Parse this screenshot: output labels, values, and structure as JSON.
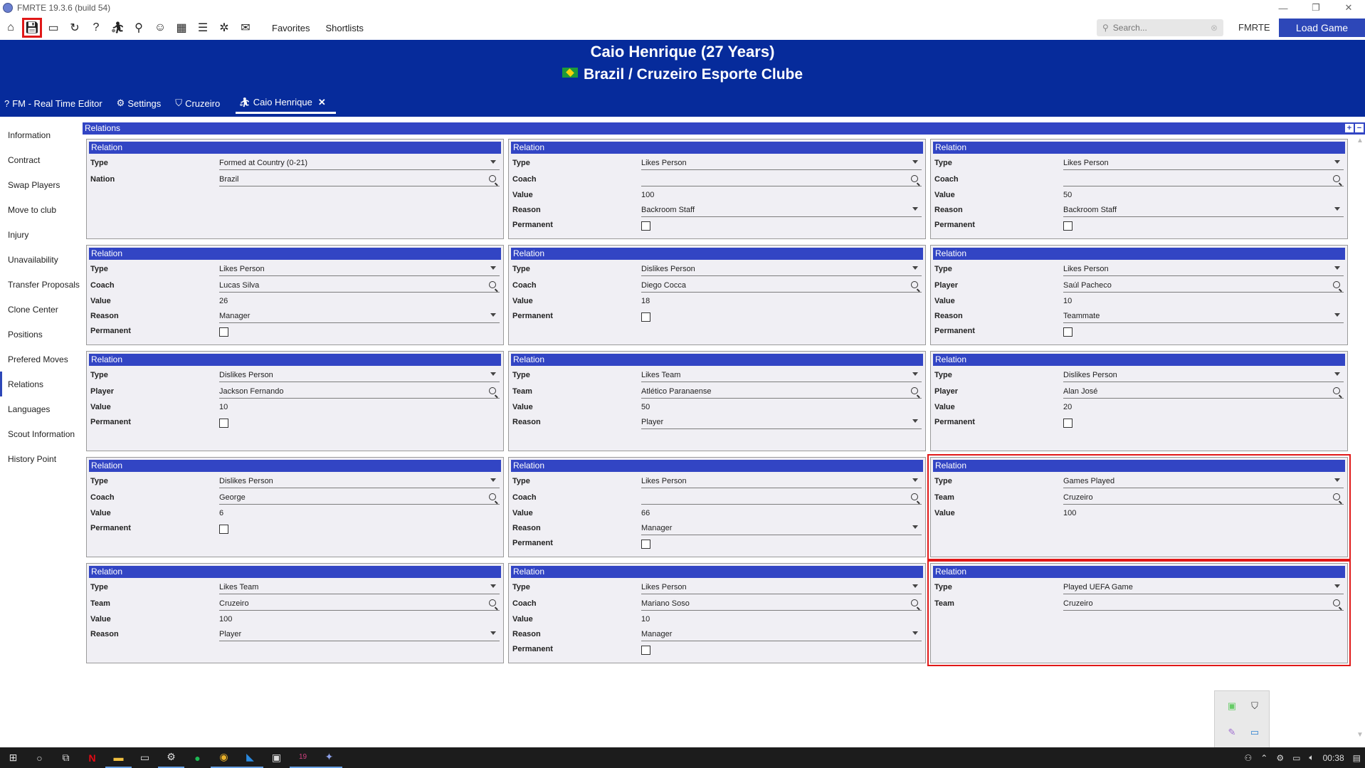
{
  "window": {
    "title": "FMRTE 19.3.6 (build 54)",
    "controls": [
      "—",
      "❐",
      "✕"
    ]
  },
  "toolbar": {
    "icons": [
      "home-icon",
      "save-icon",
      "monitor-icon",
      "refresh-icon",
      "help-icon",
      "player-icon",
      "binoculars-icon",
      "people-icon",
      "calendar-icon",
      "notes-icon",
      "soccer-icon",
      "mail-icon"
    ],
    "favorites": "Favorites",
    "shortlists": "Shortlists",
    "search_placeholder": "Search...",
    "fmrte_label": "FMRTE",
    "load_game": "Load Game",
    "highlighted_icon": "save-icon"
  },
  "header": {
    "player_name": "Caio Henrique (27 Years)",
    "club_line": "Brazil / Cruzeiro Esporte Clube",
    "tabs": [
      {
        "label": "FM - Real Time Editor",
        "icon": "help-icon"
      },
      {
        "label": "Settings",
        "icon": "gear-icon"
      },
      {
        "label": "Cruzeiro",
        "icon": "shield-icon"
      },
      {
        "label": "Caio Henrique",
        "icon": "player-icon",
        "active": true
      }
    ]
  },
  "sidebar": {
    "items": [
      "Information",
      "Contract",
      "Swap Players",
      "Move to club",
      "Injury",
      "Unavailability",
      "Transfer Proposals",
      "Clone Center",
      "Positions",
      "Prefered Moves",
      "Relations",
      "Languages",
      "Scout Information",
      "History Point"
    ],
    "active": "Relations"
  },
  "main": {
    "section_title": "Relations",
    "card_header": "Relation",
    "cards": [
      {
        "rows": [
          {
            "label": "Type",
            "value": "Formed at Country (0-21)",
            "kind": "dropdown"
          },
          {
            "label": "Nation",
            "value": "Brazil",
            "kind": "search"
          }
        ]
      },
      {
        "rows": [
          {
            "label": "Type",
            "value": "Likes Person",
            "kind": "dropdown"
          },
          {
            "label": "Coach",
            "value": "",
            "kind": "search"
          },
          {
            "label": "Value",
            "value": "100",
            "kind": "text"
          },
          {
            "label": "Reason",
            "value": "Backroom Staff",
            "kind": "dropdown"
          },
          {
            "label": "Permanent",
            "value": "",
            "kind": "checkbox"
          }
        ]
      },
      {
        "rows": [
          {
            "label": "Type",
            "value": "Likes Person",
            "kind": "dropdown"
          },
          {
            "label": "Coach",
            "value": "",
            "kind": "search"
          },
          {
            "label": "Value",
            "value": "50",
            "kind": "text"
          },
          {
            "label": "Reason",
            "value": "Backroom Staff",
            "kind": "dropdown"
          },
          {
            "label": "Permanent",
            "value": "",
            "kind": "checkbox"
          }
        ]
      },
      {
        "rows": [
          {
            "label": "Type",
            "value": "Likes Person",
            "kind": "dropdown"
          },
          {
            "label": "Coach",
            "value": "Lucas Silva",
            "kind": "search"
          },
          {
            "label": "Value",
            "value": "26",
            "kind": "text"
          },
          {
            "label": "Reason",
            "value": "Manager",
            "kind": "dropdown"
          },
          {
            "label": "Permanent",
            "value": "",
            "kind": "checkbox"
          }
        ]
      },
      {
        "rows": [
          {
            "label": "Type",
            "value": "Dislikes Person",
            "kind": "dropdown"
          },
          {
            "label": "Coach",
            "value": "Diego Cocca",
            "kind": "search"
          },
          {
            "label": "Value",
            "value": "18",
            "kind": "text"
          },
          {
            "label": "Permanent",
            "value": "",
            "kind": "checkbox"
          }
        ]
      },
      {
        "rows": [
          {
            "label": "Type",
            "value": "Likes Person",
            "kind": "dropdown"
          },
          {
            "label": "Player",
            "value": "Saúl Pacheco",
            "kind": "search"
          },
          {
            "label": "Value",
            "value": "10",
            "kind": "text"
          },
          {
            "label": "Reason",
            "value": "Teammate",
            "kind": "dropdown"
          },
          {
            "label": "Permanent",
            "value": "",
            "kind": "checkbox"
          }
        ]
      },
      {
        "rows": [
          {
            "label": "Type",
            "value": "Dislikes Person",
            "kind": "dropdown"
          },
          {
            "label": "Player",
            "value": "Jackson Fernando",
            "kind": "search"
          },
          {
            "label": "Value",
            "value": "10",
            "kind": "text"
          },
          {
            "label": "Permanent",
            "value": "",
            "kind": "checkbox"
          }
        ]
      },
      {
        "rows": [
          {
            "label": "Type",
            "value": "Likes Team",
            "kind": "dropdown"
          },
          {
            "label": "Team",
            "value": "Atlético Paranaense",
            "kind": "search"
          },
          {
            "label": "Value",
            "value": "50",
            "kind": "text"
          },
          {
            "label": "Reason",
            "value": "Player",
            "kind": "dropdown"
          }
        ]
      },
      {
        "rows": [
          {
            "label": "Type",
            "value": "Dislikes Person",
            "kind": "dropdown"
          },
          {
            "label": "Player",
            "value": "Alan José",
            "kind": "search"
          },
          {
            "label": "Value",
            "value": "20",
            "kind": "text"
          },
          {
            "label": "Permanent",
            "value": "",
            "kind": "checkbox"
          }
        ]
      },
      {
        "rows": [
          {
            "label": "Type",
            "value": "Dislikes Person",
            "kind": "dropdown"
          },
          {
            "label": "Coach",
            "value": "George",
            "kind": "search"
          },
          {
            "label": "Value",
            "value": "6",
            "kind": "text"
          },
          {
            "label": "Permanent",
            "value": "",
            "kind": "checkbox"
          }
        ]
      },
      {
        "rows": [
          {
            "label": "Type",
            "value": "Likes Person",
            "kind": "dropdown"
          },
          {
            "label": "Coach",
            "value": "",
            "kind": "search"
          },
          {
            "label": "Value",
            "value": "66",
            "kind": "text"
          },
          {
            "label": "Reason",
            "value": "Manager",
            "kind": "dropdown"
          },
          {
            "label": "Permanent",
            "value": "",
            "kind": "checkbox"
          }
        ]
      },
      {
        "highlight": true,
        "rows": [
          {
            "label": "Type",
            "value": "Games Played",
            "kind": "dropdown"
          },
          {
            "label": "Team",
            "value": "Cruzeiro",
            "kind": "search"
          },
          {
            "label": "Value",
            "value": "100",
            "kind": "text"
          }
        ]
      },
      {
        "rows": [
          {
            "label": "Type",
            "value": "Likes Team",
            "kind": "dropdown"
          },
          {
            "label": "Team",
            "value": "Cruzeiro",
            "kind": "search"
          },
          {
            "label": "Value",
            "value": "100",
            "kind": "text"
          },
          {
            "label": "Reason",
            "value": "Player",
            "kind": "dropdown"
          }
        ]
      },
      {
        "rows": [
          {
            "label": "Type",
            "value": "Likes Person",
            "kind": "dropdown"
          },
          {
            "label": "Coach",
            "value": "Mariano Soso",
            "kind": "search"
          },
          {
            "label": "Value",
            "value": "10",
            "kind": "text"
          },
          {
            "label": "Reason",
            "value": "Manager",
            "kind": "dropdown"
          },
          {
            "label": "Permanent",
            "value": "",
            "kind": "checkbox"
          }
        ]
      },
      {
        "highlight": true,
        "rows": [
          {
            "label": "Type",
            "value": "Played UEFA Game",
            "kind": "dropdown"
          },
          {
            "label": "Team",
            "value": "Cruzeiro",
            "kind": "search"
          }
        ]
      }
    ]
  },
  "taskbar": {
    "apps": [
      "windows-start-icon",
      "cortana-icon",
      "task-view-icon",
      "netflix-icon",
      "file-explorer-icon",
      "terminal-icon",
      "steam-icon",
      "spotify-icon",
      "chrome-icon",
      "vscode-icon",
      "photos-icon",
      "fm19-icon",
      "fmrte-icon"
    ],
    "clock": "00:38"
  },
  "colors": {
    "header_bg": "#062b9b",
    "card_header_bg": "#3245c4",
    "load_game_bg": "#2d47b8",
    "highlight": "#e01818"
  }
}
